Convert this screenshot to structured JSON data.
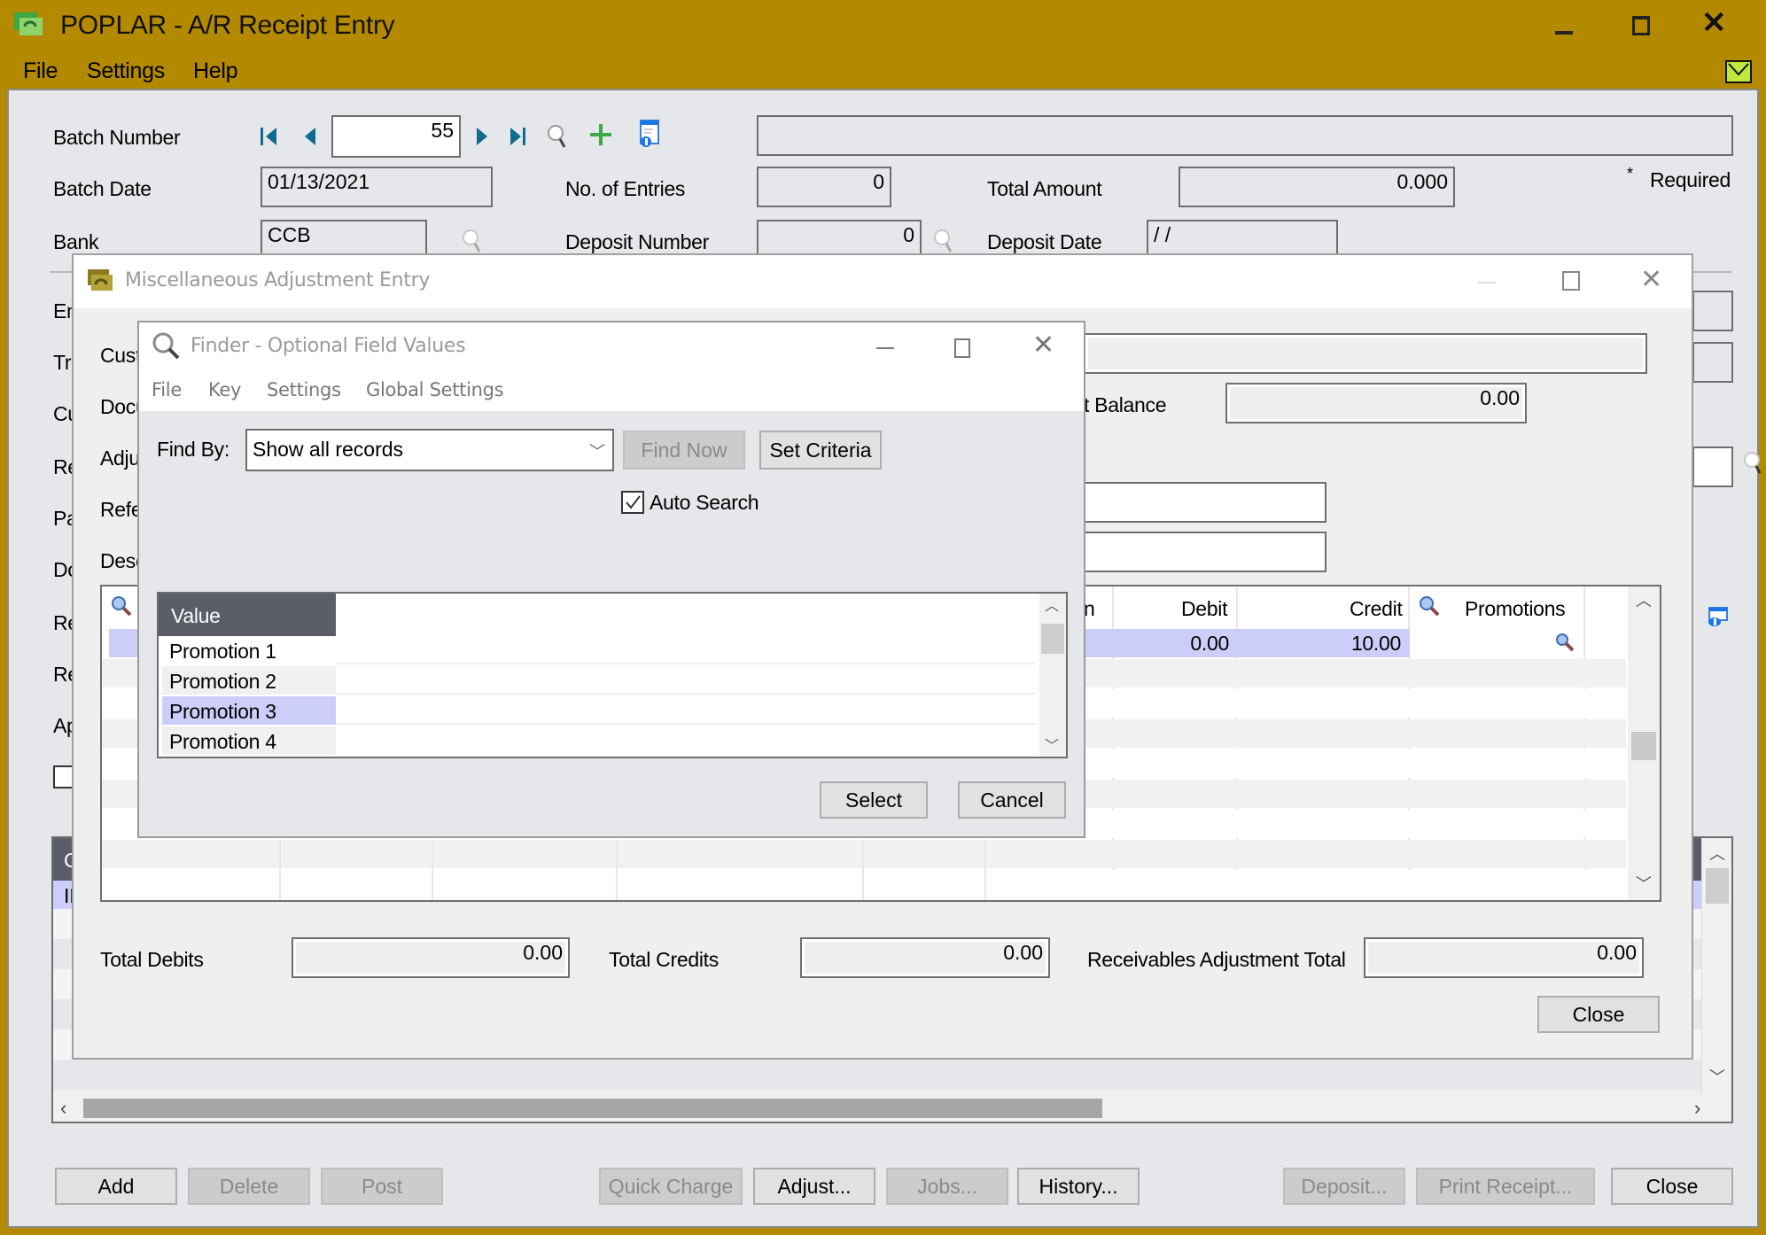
{
  "window": {
    "title": "POPLAR - A/R Receipt Entry",
    "menu": [
      "File",
      "Settings",
      "Help"
    ],
    "controls": {
      "minimize": "minimize-icon",
      "maximize": "maximize-icon",
      "close": "close-icon"
    },
    "accent": "#B38900"
  },
  "header": {
    "batch_number_label": "Batch Number",
    "batch_number": "55",
    "batch_description": "",
    "batch_date_label": "Batch Date",
    "batch_date": "01/13/2021",
    "entries_label": "No. of Entries",
    "entries": "0",
    "total_amount_label": "Total Amount",
    "total_amount": "0.000",
    "required_marker": "*",
    "required_label": "Required",
    "bank_label": "Bank",
    "bank": "CCB",
    "deposit_number_label": "Deposit Number",
    "deposit_number": "0",
    "deposit_date_label": "Deposit Date",
    "deposit_date": " /  /"
  },
  "main_labels_partial": [
    "En",
    "Tra",
    "Cu",
    "Re",
    "Pa",
    "Do",
    "Re",
    "Re",
    "Ap"
  ],
  "background_grid": {
    "header_partial": "C",
    "first_row_partial": "II"
  },
  "footer_buttons": [
    {
      "label": "Add",
      "enabled": true
    },
    {
      "label": "Delete",
      "enabled": false
    },
    {
      "label": "Post",
      "enabled": false
    },
    {
      "label": "Quick Charge",
      "enabled": false
    },
    {
      "label": "Adjust...",
      "enabled": true
    },
    {
      "label": "Jobs...",
      "enabled": false
    },
    {
      "label": "History...",
      "enabled": true
    },
    {
      "label": "Deposit...",
      "enabled": false
    },
    {
      "label": "Print Receipt...",
      "enabled": false
    },
    {
      "label": "Close",
      "enabled": true
    }
  ],
  "misc_dialog": {
    "title": "Miscellaneous Adjustment Entry",
    "labels_partial": [
      "Cust",
      "Docu",
      "Adju",
      "Refe",
      "Desc"
    ],
    "balance_label_partial": "t Balance",
    "balance": "0.00",
    "grid": {
      "columns": [
        "",
        "",
        "",
        "",
        "n",
        "Debit",
        "Credit",
        "Promotions"
      ],
      "rows": [
        {
          "debit": "0.00",
          "credit": "10.00",
          "promotions": ""
        }
      ]
    },
    "total_debits_label": "Total Debits",
    "total_debits": "0.00",
    "total_credits_label": "Total Credits",
    "total_credits": "0.00",
    "rec_adj_total_label": "Receivables Adjustment Total",
    "rec_adj_total": "0.00",
    "close_label": "Close"
  },
  "finder": {
    "title": "Finder - Optional Field Values",
    "menu": [
      "File",
      "Key",
      "Settings",
      "Global Settings"
    ],
    "find_by_label": "Find By:",
    "find_by_value": "Show all records",
    "find_now_label": "Find Now",
    "set_criteria_label": "Set Criteria",
    "auto_search_label": "Auto Search",
    "auto_search_checked": true,
    "column_header": "Value",
    "rows": [
      "Promotion 1",
      "Promotion 2",
      "Promotion 3",
      "Promotion 4"
    ],
    "selected_row": "Promotion 3",
    "select_label": "Select",
    "cancel_label": "Cancel"
  }
}
